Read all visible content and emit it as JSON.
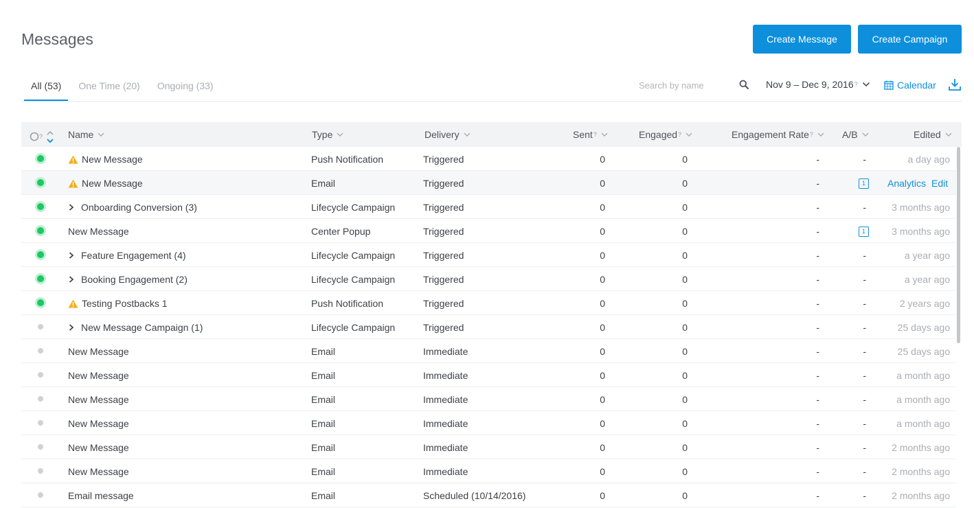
{
  "header": {
    "title": "Messages",
    "create_message": "Create Message",
    "create_campaign": "Create Campaign"
  },
  "tabs": [
    {
      "label": "All (53)",
      "active": true
    },
    {
      "label": "One Time (20)",
      "active": false
    },
    {
      "label": "Ongoing (33)",
      "active": false
    }
  ],
  "toolbar": {
    "search_placeholder": "Search by name",
    "date_range": "Nov 9 – Dec 9, 2016",
    "date_hint": "?",
    "calendar": "Calendar"
  },
  "table": {
    "columns": {
      "status_hint": "?",
      "name": "Name",
      "type": "Type",
      "delivery": "Delivery",
      "sent": "Sent",
      "sent_hint": "?",
      "engaged": "Engaged",
      "engaged_hint": "?",
      "engagement_rate": "Engagement Rate",
      "engagement_rate_hint": "?",
      "ab": "A/B",
      "edited": "Edited"
    },
    "rows": [
      {
        "status": "live",
        "warn": true,
        "expand": false,
        "name": "New Message",
        "type": "Push Notification",
        "delivery": "Triggered",
        "sent": "0",
        "engaged": "0",
        "rate": "-",
        "ab": "-",
        "edited": "a day ago"
      },
      {
        "status": "live",
        "warn": true,
        "expand": false,
        "name": "New Message",
        "type": "Email",
        "delivery": "Triggered",
        "sent": "0",
        "engaged": "0",
        "rate": "-",
        "ab": "1",
        "edited": "",
        "hover": true,
        "analytics": "Analytics",
        "edit": "Edit"
      },
      {
        "status": "live",
        "warn": false,
        "expand": true,
        "name": "Onboarding Conversion (3)",
        "type": "Lifecycle Campaign",
        "delivery": "Triggered",
        "sent": "0",
        "engaged": "0",
        "rate": "-",
        "ab": "-",
        "edited": "3 months ago"
      },
      {
        "status": "live",
        "warn": false,
        "expand": false,
        "name": "New Message",
        "type": "Center Popup",
        "delivery": "Triggered",
        "sent": "0",
        "engaged": "0",
        "rate": "-",
        "ab": "1",
        "edited": "3 months ago"
      },
      {
        "status": "live",
        "warn": false,
        "expand": true,
        "name": "Feature Engagement (4)",
        "type": "Lifecycle Campaign",
        "delivery": "Triggered",
        "sent": "0",
        "engaged": "0",
        "rate": "-",
        "ab": "-",
        "edited": "a year ago"
      },
      {
        "status": "live",
        "warn": false,
        "expand": true,
        "name": "Booking Engagement (2)",
        "type": "Lifecycle Campaign",
        "delivery": "Triggered",
        "sent": "0",
        "engaged": "0",
        "rate": "-",
        "ab": "-",
        "edited": "a year ago"
      },
      {
        "status": "live",
        "warn": true,
        "expand": false,
        "name": "Testing Postbacks 1",
        "type": "Push Notification",
        "delivery": "Triggered",
        "sent": "0",
        "engaged": "0",
        "rate": "-",
        "ab": "-",
        "edited": "2 years ago"
      },
      {
        "status": "off",
        "warn": false,
        "expand": true,
        "name": "New Message Campaign (1)",
        "type": "Lifecycle Campaign",
        "delivery": "Triggered",
        "sent": "0",
        "engaged": "0",
        "rate": "-",
        "ab": "-",
        "edited": "25 days ago"
      },
      {
        "status": "off",
        "warn": false,
        "expand": false,
        "name": "New Message",
        "type": "Email",
        "delivery": "Immediate",
        "sent": "0",
        "engaged": "0",
        "rate": "-",
        "ab": "-",
        "edited": "25 days ago"
      },
      {
        "status": "off",
        "warn": false,
        "expand": false,
        "name": "New Message",
        "type": "Email",
        "delivery": "Immediate",
        "sent": "0",
        "engaged": "0",
        "rate": "-",
        "ab": "-",
        "edited": "a month ago"
      },
      {
        "status": "off",
        "warn": false,
        "expand": false,
        "name": "New Message",
        "type": "Email",
        "delivery": "Immediate",
        "sent": "0",
        "engaged": "0",
        "rate": "-",
        "ab": "-",
        "edited": "a month ago"
      },
      {
        "status": "off",
        "warn": false,
        "expand": false,
        "name": "New Message",
        "type": "Email",
        "delivery": "Immediate",
        "sent": "0",
        "engaged": "0",
        "rate": "-",
        "ab": "-",
        "edited": "a month ago"
      },
      {
        "status": "off",
        "warn": false,
        "expand": false,
        "name": "New Message",
        "type": "Email",
        "delivery": "Immediate",
        "sent": "0",
        "engaged": "0",
        "rate": "-",
        "ab": "-",
        "edited": "2 months ago"
      },
      {
        "status": "off",
        "warn": false,
        "expand": false,
        "name": "New Message",
        "type": "Email",
        "delivery": "Immediate",
        "sent": "0",
        "engaged": "0",
        "rate": "-",
        "ab": "-",
        "edited": "2 months ago"
      },
      {
        "status": "off",
        "warn": false,
        "expand": false,
        "name": "Email message",
        "type": "Email",
        "delivery": "Scheduled (10/14/2016)",
        "sent": "0",
        "engaged": "0",
        "rate": "-",
        "ab": "-",
        "edited": "2 months ago"
      }
    ]
  },
  "colors": {
    "accent": "#0d8fdc",
    "live": "#1cc862",
    "warning": "#f2b01e",
    "inactive": "#cfd2d5"
  }
}
